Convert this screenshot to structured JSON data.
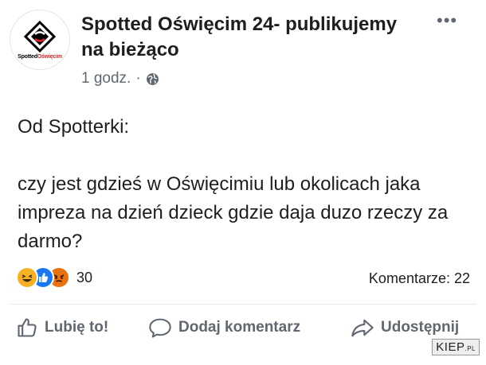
{
  "post": {
    "page_name": "Spotted Oświęcim 24- publikujemy na bieżąco",
    "time": "1 godz.",
    "separator": "·",
    "more_icon": "more-horizontal-icon",
    "privacy_icon": "globe-icon",
    "avatar": {
      "logo_part1": "Spotted",
      "logo_part2": "Oświęcim",
      "accent_color": "#d8232a"
    },
    "text": {
      "line1": "Od Spotterki:",
      "line2": "czy jest gdzieś w Oświęcimiu lub okolicach jaka impreza na dzień dzieck gdzie daja duzo rzeczy za darmo?"
    }
  },
  "stats": {
    "reactions": [
      "haha",
      "like",
      "angry"
    ],
    "reaction_count": "30",
    "comments": "Komentarze: 22"
  },
  "actions": {
    "like_label": "Lubię to!",
    "comment_label": "Dodaj komentarz",
    "share_label": "Udostępnij"
  },
  "watermark": {
    "text": "KIEP",
    "suffix": ".PL"
  },
  "colors": {
    "link_blue": "#1877f2",
    "haha": "#f7b125",
    "angry": "#e9710f",
    "muted": "#606770"
  }
}
